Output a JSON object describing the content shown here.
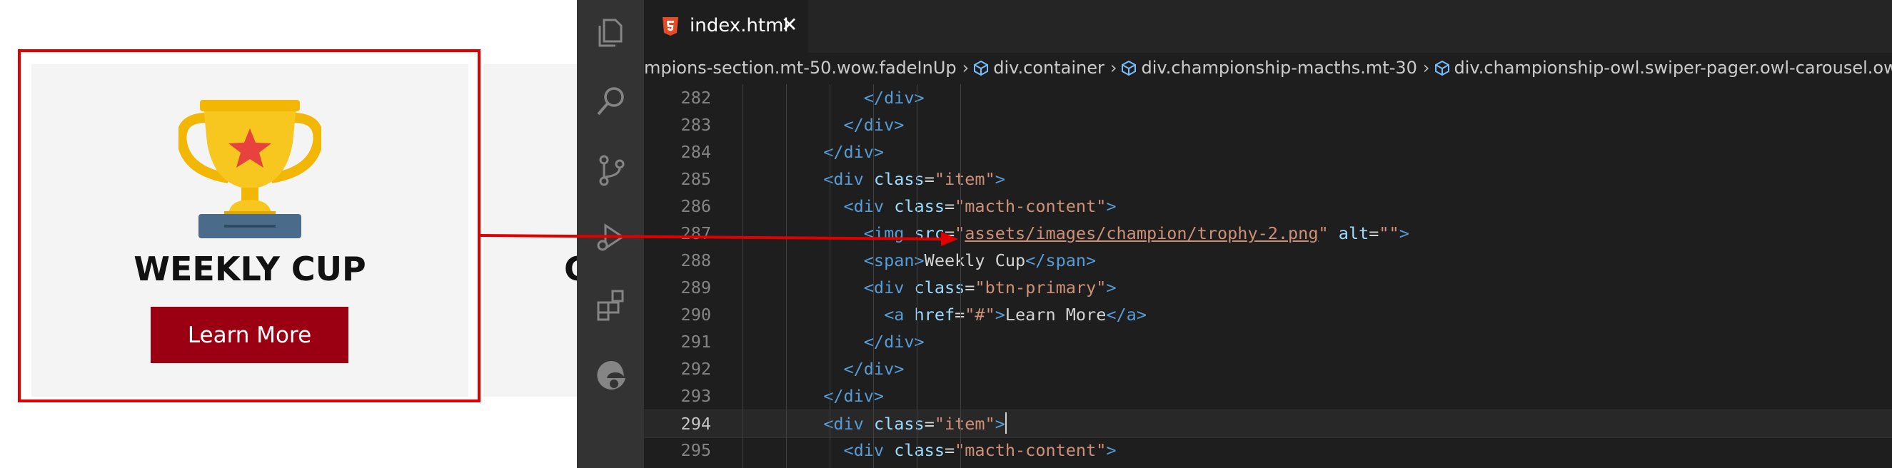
{
  "preview": {
    "card_title": "WEEKLY CUP",
    "learn_more": "Learn More",
    "next_card_letter": "C"
  },
  "editor": {
    "tab_label": "index.html",
    "tab_close": "✕",
    "breadcrumb": [
      "mpions-section.mt-50.wow.fadeInUp",
      "div.container",
      "div.championship-macths.mt-30",
      "div.championship-owl.swiper-pager.owl-carousel.ow"
    ],
    "lines": [
      {
        "n": "282",
        "indent": "            ",
        "tokens": [
          [
            "t-tag",
            "</"
          ],
          [
            "t-tag",
            "div"
          ],
          [
            "t-tag",
            ">"
          ]
        ]
      },
      {
        "n": "283",
        "indent": "          ",
        "tokens": [
          [
            "t-tag",
            "</"
          ],
          [
            "t-tag",
            "div"
          ],
          [
            "t-tag",
            ">"
          ]
        ]
      },
      {
        "n": "284",
        "indent": "        ",
        "tokens": [
          [
            "t-tag",
            "</"
          ],
          [
            "t-tag",
            "div"
          ],
          [
            "t-tag",
            ">"
          ]
        ]
      },
      {
        "n": "285",
        "indent": "        ",
        "tokens": [
          [
            "t-tag",
            "<div "
          ],
          [
            "t-attr",
            "class"
          ],
          [
            "t-text",
            "="
          ],
          [
            "t-str",
            "\"item\""
          ],
          [
            "t-tag",
            ">"
          ]
        ]
      },
      {
        "n": "286",
        "indent": "          ",
        "tokens": [
          [
            "t-tag",
            "<div "
          ],
          [
            "t-attr",
            "class"
          ],
          [
            "t-text",
            "="
          ],
          [
            "t-str",
            "\"macth-content\""
          ],
          [
            "t-tag",
            ">"
          ]
        ]
      },
      {
        "n": "287",
        "indent": "            ",
        "tokens": [
          [
            "t-tag",
            "<img "
          ],
          [
            "t-attr",
            "src"
          ],
          [
            "t-text",
            "="
          ],
          [
            "t-str",
            "\""
          ],
          [
            "t-link",
            "assets/images/champion/trophy-2.png"
          ],
          [
            "t-str",
            "\""
          ],
          [
            "t-text",
            " "
          ],
          [
            "t-attr",
            "alt"
          ],
          [
            "t-text",
            "="
          ],
          [
            "t-str",
            "\"\""
          ],
          [
            "t-tag",
            ">"
          ]
        ]
      },
      {
        "n": "288",
        "indent": "            ",
        "tokens": [
          [
            "t-tag",
            "<span>"
          ],
          [
            "t-text",
            "Weekly Cup"
          ],
          [
            "t-tag",
            "</span>"
          ]
        ]
      },
      {
        "n": "289",
        "indent": "            ",
        "tokens": [
          [
            "t-tag",
            "<div "
          ],
          [
            "t-attr",
            "class"
          ],
          [
            "t-text",
            "="
          ],
          [
            "t-str",
            "\"btn-primary\""
          ],
          [
            "t-tag",
            ">"
          ]
        ]
      },
      {
        "n": "290",
        "indent": "              ",
        "tokens": [
          [
            "t-tag",
            "<a "
          ],
          [
            "t-attr",
            "href"
          ],
          [
            "t-text",
            "="
          ],
          [
            "t-str",
            "\"#\""
          ],
          [
            "t-tag",
            ">"
          ],
          [
            "t-text",
            "Learn More"
          ],
          [
            "t-tag",
            "</a>"
          ]
        ]
      },
      {
        "n": "291",
        "indent": "            ",
        "tokens": [
          [
            "t-tag",
            "</div>"
          ]
        ]
      },
      {
        "n": "292",
        "indent": "          ",
        "tokens": [
          [
            "t-tag",
            "</div>"
          ]
        ]
      },
      {
        "n": "293",
        "indent": "        ",
        "tokens": [
          [
            "t-tag",
            "</div>"
          ]
        ]
      },
      {
        "n": "294",
        "indent": "        ",
        "tokens": [
          [
            "t-tag",
            "<div "
          ],
          [
            "t-attr",
            "class"
          ],
          [
            "t-text",
            "="
          ],
          [
            "t-str",
            "\"item\""
          ],
          [
            "t-tag",
            ">"
          ]
        ],
        "current": true
      },
      {
        "n": "295",
        "indent": "          ",
        "tokens": [
          [
            "t-tag",
            "<div "
          ],
          [
            "t-attr",
            "class"
          ],
          [
            "t-text",
            "="
          ],
          [
            "t-str",
            "\"macth-content\""
          ],
          [
            "t-tag",
            ">"
          ]
        ]
      }
    ]
  },
  "colors": {
    "highlight": "#e10000",
    "button_bg": "#9b0012",
    "editor_bg": "#1e1e1e",
    "activity_bar": "#333333"
  },
  "icons": [
    "explorer-icon",
    "search-icon",
    "source-control-icon",
    "run-debug-icon",
    "extensions-icon",
    "edge-icon",
    "html5-icon",
    "trophy-icon"
  ]
}
